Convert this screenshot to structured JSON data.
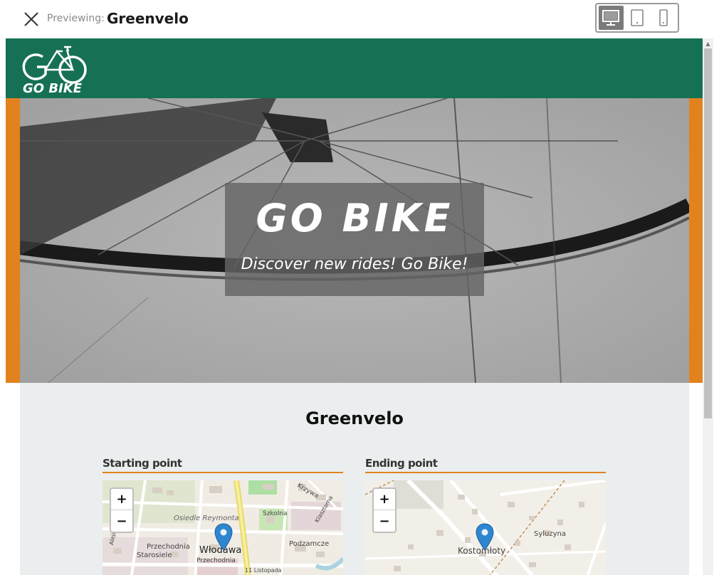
{
  "toolbar": {
    "previewing_label": "Previewing:",
    "title": "Greenvelo",
    "devices": [
      "desktop",
      "tablet",
      "mobile"
    ],
    "active_device": "desktop"
  },
  "site": {
    "logo_text": "GO BIKE",
    "header_color": "#167055",
    "accent_color": "#e2821f"
  },
  "hero": {
    "title": "GO BIKE",
    "subtitle": "Discover new rides! Go Bike!"
  },
  "content": {
    "title": "Greenvelo",
    "starting_label": "Starting point",
    "ending_label": "Ending point"
  },
  "map_start": {
    "zoom_in": "+",
    "zoom_out": "−",
    "labels": [
      "Osiedle Reymonta",
      "Przechodnia",
      "Starosiele",
      "Włodawa",
      "Przechodnia",
      "Szkolna",
      "Krzywa",
      "Klasztorna",
      "Podzamcze",
      "Aleja Jana Pawła II",
      "11 Listopada"
    ]
  },
  "map_end": {
    "zoom_in": "+",
    "zoom_out": "−",
    "labels": [
      "Kostomłoty",
      "Syluzyna"
    ]
  }
}
